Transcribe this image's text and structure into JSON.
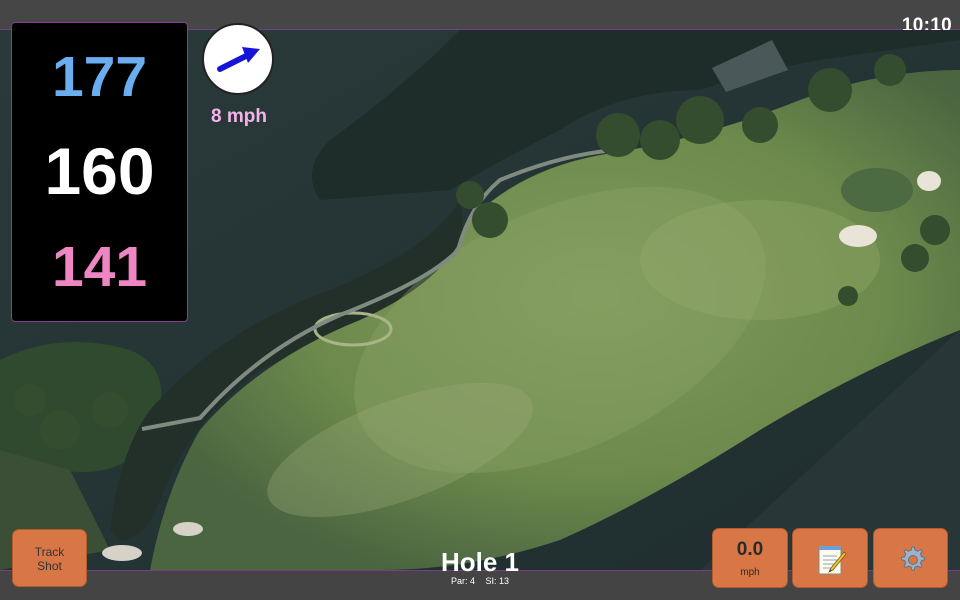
{
  "status": {
    "time": "10:10"
  },
  "distances": {
    "back": "177",
    "center": "160",
    "front": "141"
  },
  "wind": {
    "speed_label": "8 mph",
    "direction_icon": "wind-arrow-icon"
  },
  "hole": {
    "title": "Hole 1",
    "par_label": "Par: 4",
    "si_label": "SI: 13"
  },
  "buttons": {
    "track_shot_line1": "Track",
    "track_shot_line2": "Shot",
    "speed_value": "0.0",
    "speed_unit": "mph",
    "notes_icon": "notepad-icon",
    "settings_icon": "gear-icon"
  },
  "colors": {
    "back_distance": "#6aaef0",
    "center_distance": "#ffffff",
    "front_distance": "#ef86c4",
    "button_accent": "#d87645",
    "wind_text": "#f5b4e8",
    "border_accent": "#8a3d93"
  }
}
